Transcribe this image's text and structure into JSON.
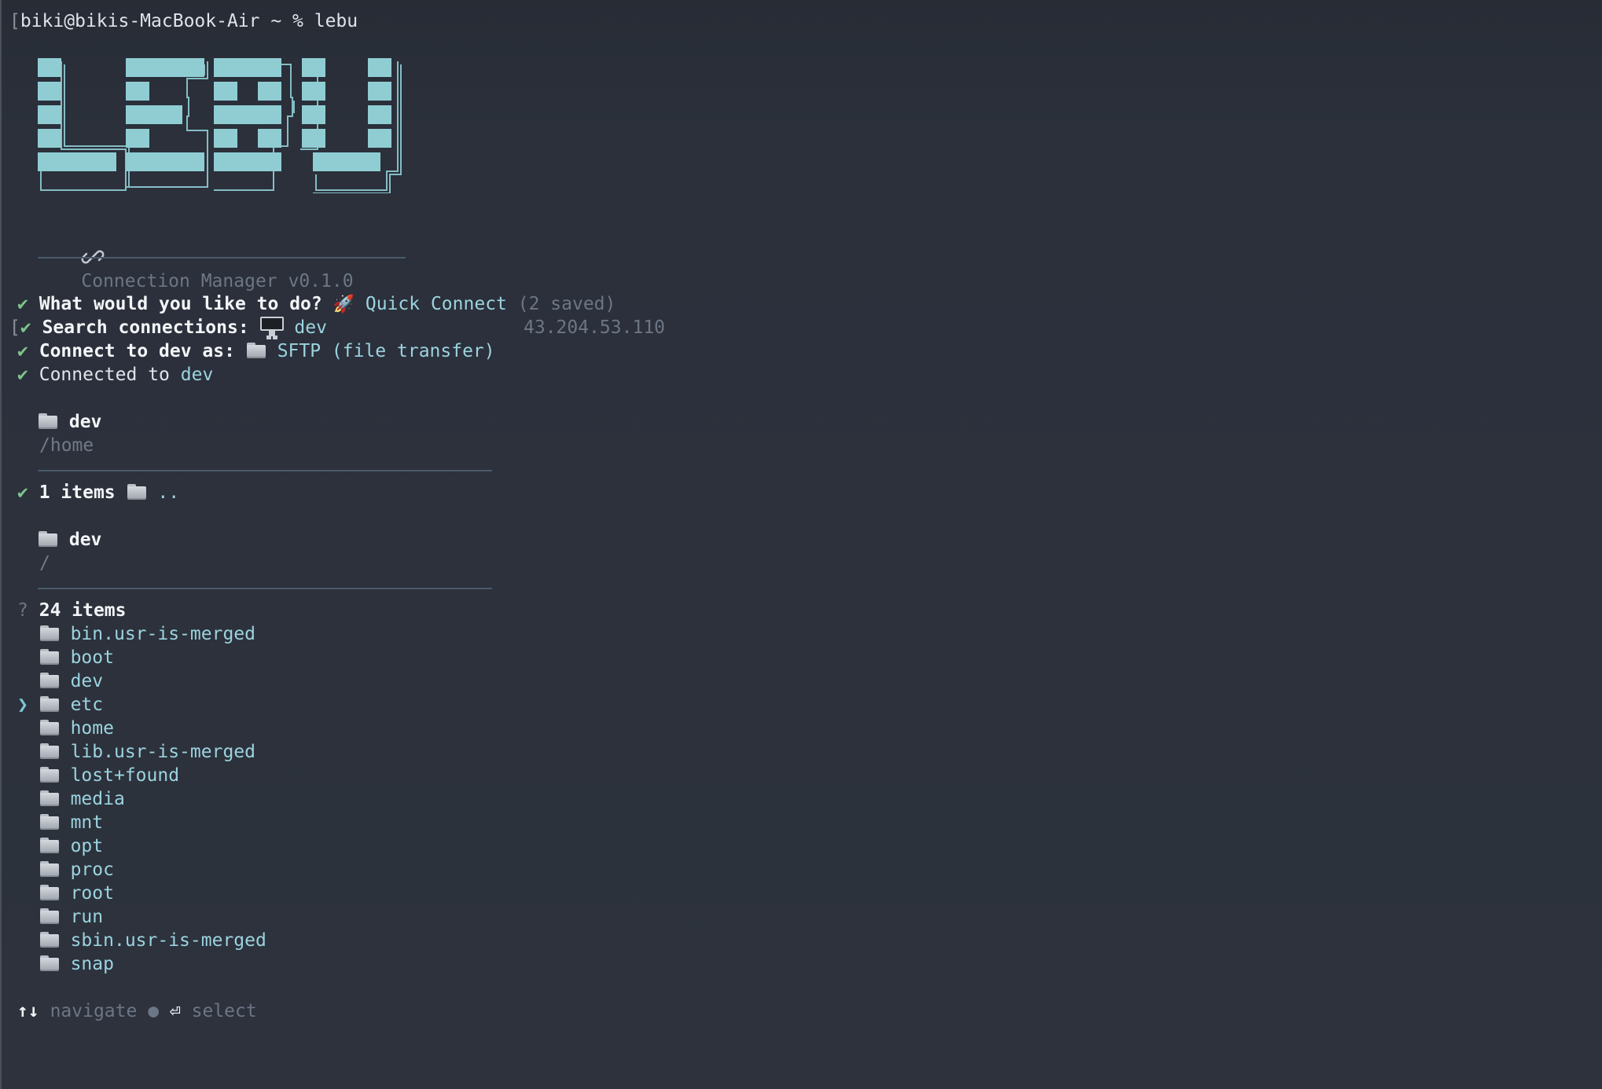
{
  "terminal": {
    "prompt": "biki@bikis-MacBook-Air ~ % lebu"
  },
  "header": {
    "subtitle": "Connection Manager v0.1.0"
  },
  "steps": [
    {
      "mark": "✔",
      "question": "What would you like to do?",
      "answer": "Quick Connect",
      "extra": "(2 saved)"
    },
    {
      "mark": "✔",
      "question": "Search connections:",
      "answer": "dev",
      "extra": "43.204.53.110"
    },
    {
      "mark": "✔",
      "question": "Connect to dev as:",
      "answer": "SFTP (file transfer)"
    },
    {
      "mark": "✔",
      "text": "Connected to",
      "answer": "dev"
    }
  ],
  "panel1": {
    "title": "dev",
    "path": "/home"
  },
  "result1": {
    "mark": "✔",
    "count": "1 items",
    "selection": ".."
  },
  "panel2": {
    "title": "dev",
    "path": "/"
  },
  "list": {
    "mark": "?",
    "count": "24 items",
    "selected_index": 3,
    "items": [
      "bin.usr-is-merged",
      "boot",
      "dev",
      "etc",
      "home",
      "lib.usr-is-merged",
      "lost+found",
      "media",
      "mnt",
      "opt",
      "proc",
      "root",
      "run",
      "sbin.usr-is-merged",
      "snap"
    ]
  },
  "footer": {
    "navigate_label": "navigate",
    "select_label": "select",
    "navigate_symbol": "↑↓",
    "select_symbol": "⏎"
  },
  "colors": {
    "accent": "#9bd3de",
    "check": "#7fc48a",
    "logo_fill": "#8fcdd3"
  }
}
